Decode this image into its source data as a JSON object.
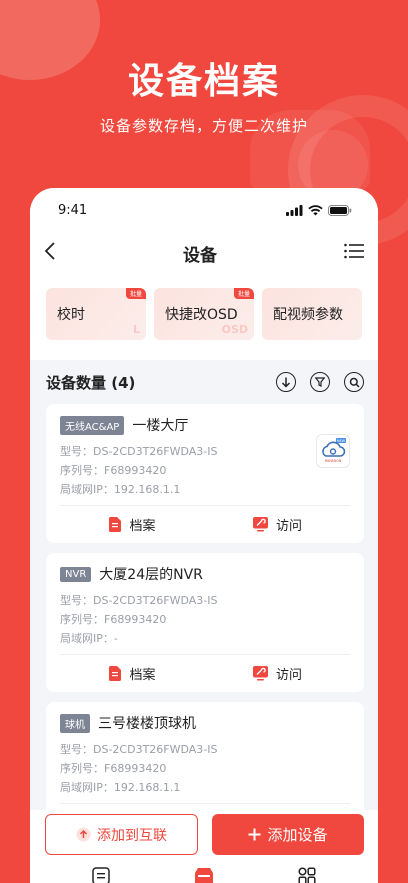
{
  "promo": {
    "title": "设备档案",
    "subtitle": "设备参数存档，方便二次维护"
  },
  "status_bar": {
    "time": "9:41"
  },
  "nav": {
    "title": "设备"
  },
  "quick_actions": [
    {
      "label": "校时",
      "badge": "批量",
      "deco": "L"
    },
    {
      "label": "快捷改OSD",
      "badge": "批量",
      "deco": "OSD"
    },
    {
      "label": "配视频参数",
      "badge": "",
      "deco": ""
    }
  ],
  "device_count_label": "设备数量 (4)",
  "devices": [
    {
      "tag": "无线AC&AP",
      "name": "一楼大厅",
      "model": "型号：DS-2CD3T26FWDA3-IS",
      "serial": "序列号：F68993420",
      "ip": "局域网IP：192.168.1.1",
      "has_thumbnail": true
    },
    {
      "tag": "NVR",
      "name": "大厦24层的NVR",
      "model": "型号：DS-2CD3T26FWDA3-IS",
      "serial": "序列号：F68993420",
      "ip": "局域网IP：-",
      "has_thumbnail": false
    },
    {
      "tag": "球机",
      "name": "三号楼楼顶球机",
      "model": "型号：DS-2CD3T26FWDA3-IS",
      "serial": "序列号：F68993420",
      "ip": "局域网IP：192.168.1.1",
      "has_thumbnail": false
    }
  ],
  "device_actions": {
    "archive": "档案",
    "visit": "访问"
  },
  "thumbnail": {
    "brand": "HIKVISION",
    "badge": "NEW"
  },
  "bottom": {
    "add_interconnect": "添加到互联",
    "add_device": "添加设备"
  },
  "colors": {
    "brand": "#F0483E",
    "tag": "#7D8594",
    "page_bg": "#F4F5F8"
  }
}
